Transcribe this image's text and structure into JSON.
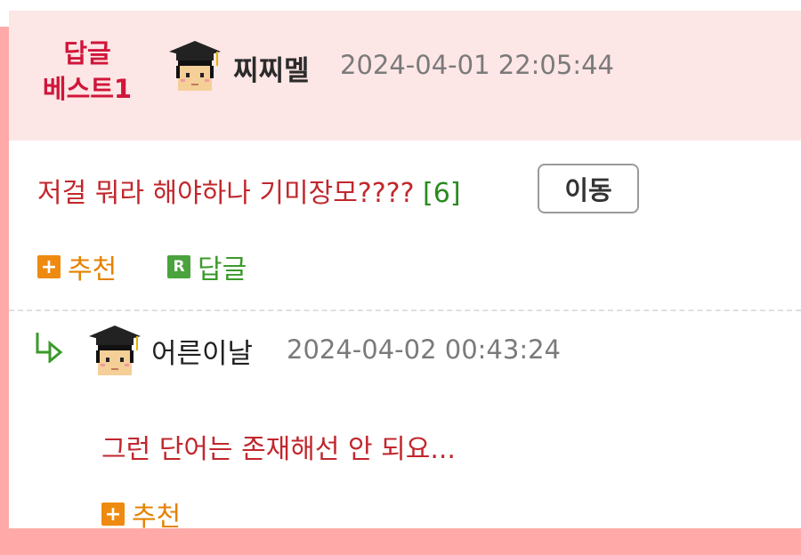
{
  "best_comment": {
    "badge_line1": "답글",
    "badge_line2": "베스트1",
    "author": "찌찌멜",
    "timestamp": "2024-04-01 22:05:44",
    "text": "저걸 뭐라 해야하나 기미장모????",
    "reply_count": "[6]",
    "move_button": "이동",
    "recommend_label": "추천",
    "recommend_icon": "+",
    "reply_label": "답글",
    "reply_icon": "R"
  },
  "reply": {
    "author": "어른이날",
    "timestamp": "2024-04-02 00:43:24",
    "text": "그런 단어는 존재해선 안 되요...",
    "recommend_label": "추천",
    "recommend_icon": "+"
  },
  "colors": {
    "frame": "#ffaaa8",
    "header_bg": "#fde6e6",
    "badge": "#d0163a",
    "comment_text": "#c1272d",
    "reply_count": "#2a8a20",
    "recommend": "#ef8a10",
    "reply_badge": "#4aa33c"
  },
  "icons": {
    "avatar": "graduate-avatar-icon",
    "reply_arrow": "reply-arrow-icon"
  }
}
